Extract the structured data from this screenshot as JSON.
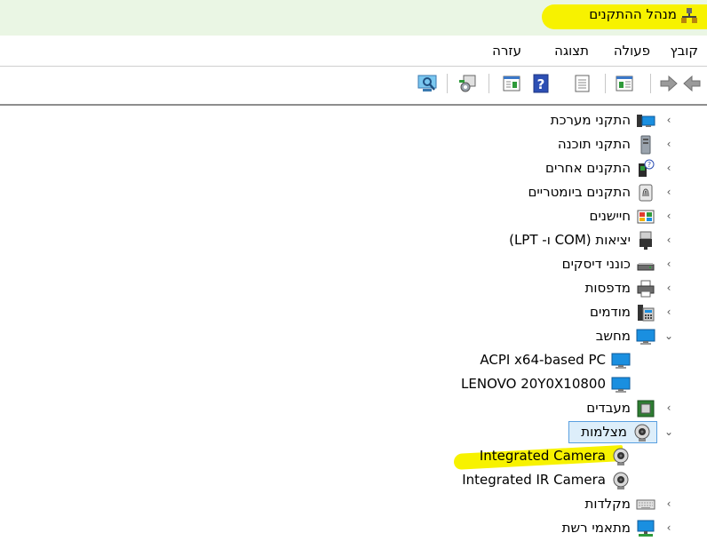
{
  "window": {
    "title": "מנהל ההתקנים",
    "highlight_color": "#f7f200"
  },
  "menu": {
    "items": [
      "קובץ",
      "פעולה",
      "תצוגה",
      "עזרה"
    ]
  },
  "toolbar": {
    "buttons": [
      "back-arrow-icon",
      "forward-arrow-icon",
      "show-hide-tree-icon",
      "properties-icon",
      "help-icon",
      "update-driver-icon",
      "uninstall-icon",
      "scan-hardware-icon"
    ]
  },
  "tree": {
    "system_devices": "התקני מערכת",
    "software_devices": "התקני תוכנה",
    "other_devices": "התקנים אחרים",
    "biometric_devices": "התקנים ביומטריים",
    "sensors": "חיישנים",
    "ports": "יציאות (COM ו- LPT)",
    "disk_drives": "כונני דיסקים",
    "printers": "מדפסות",
    "modems": "מודמים",
    "computer": "מחשב",
    "computer_child_1": "ACPI x64-based PC",
    "computer_child_2": "LENOVO 20Y0X10800",
    "processors": "מעבדים",
    "cameras": "מצלמות",
    "camera_child_1": "Integrated Camera",
    "camera_child_2": "Integrated IR Camera",
    "keyboards": "מקלדות",
    "network_adapters": "מתאמי רשת"
  },
  "colors": {
    "title_bar": "#eaf6e4",
    "selection": "#ddeefa",
    "selection_border": "#5aa0e0",
    "monitor_blue": "#1a8fe0"
  }
}
